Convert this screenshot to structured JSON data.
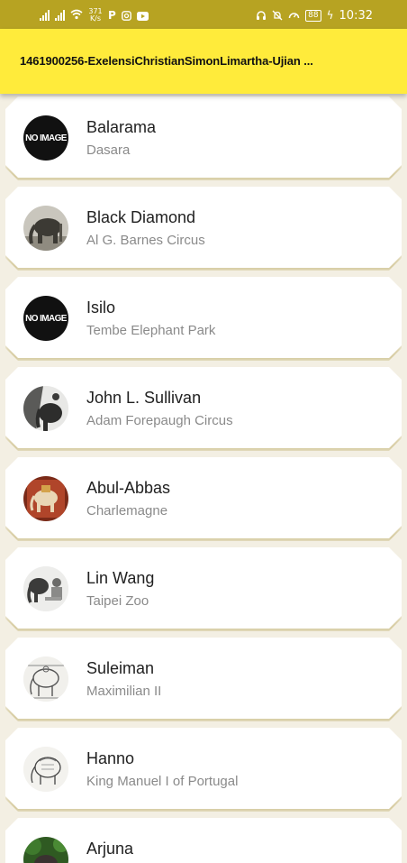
{
  "status_bar": {
    "network_speed_value": "371",
    "network_speed_unit": "K/s",
    "battery": "88",
    "time": "10:32",
    "icons": [
      "signal-icon",
      "signal-icon",
      "wifi-icon",
      "parking-icon",
      "instagram-icon",
      "youtube-icon",
      "headset-icon",
      "mute-icon",
      "speedometer-icon",
      "battery-icon",
      "charging-icon"
    ]
  },
  "app_bar": {
    "title": "1461900256-ExelensiChristianSimonLimartha-Ujian ..."
  },
  "elephants": [
    {
      "name": "Balarama",
      "subtitle": "Dasara",
      "image": "NO IMAGE"
    },
    {
      "name": "Black Diamond",
      "subtitle": "Al G. Barnes Circus",
      "image": "photo"
    },
    {
      "name": "Isilo",
      "subtitle": "Tembe Elephant Park",
      "image": "NO IMAGE"
    },
    {
      "name": "John L. Sullivan",
      "subtitle": "Adam Forepaugh Circus",
      "image": "photo"
    },
    {
      "name": "Abul-Abbas",
      "subtitle": "Charlemagne",
      "image": "photo"
    },
    {
      "name": "Lin Wang",
      "subtitle": "Taipei Zoo",
      "image": "photo"
    },
    {
      "name": "Suleiman",
      "subtitle": "Maximilian II",
      "image": "photo"
    },
    {
      "name": "Hanno",
      "subtitle": "King Manuel I of Portugal",
      "image": "photo"
    },
    {
      "name": "Arjuna",
      "subtitle": "",
      "image": "photo"
    }
  ],
  "colors": {
    "status_bar": "#b7a322",
    "app_bar": "#ffeb3b",
    "background": "#f3efe3",
    "card": "#ffffff"
  }
}
